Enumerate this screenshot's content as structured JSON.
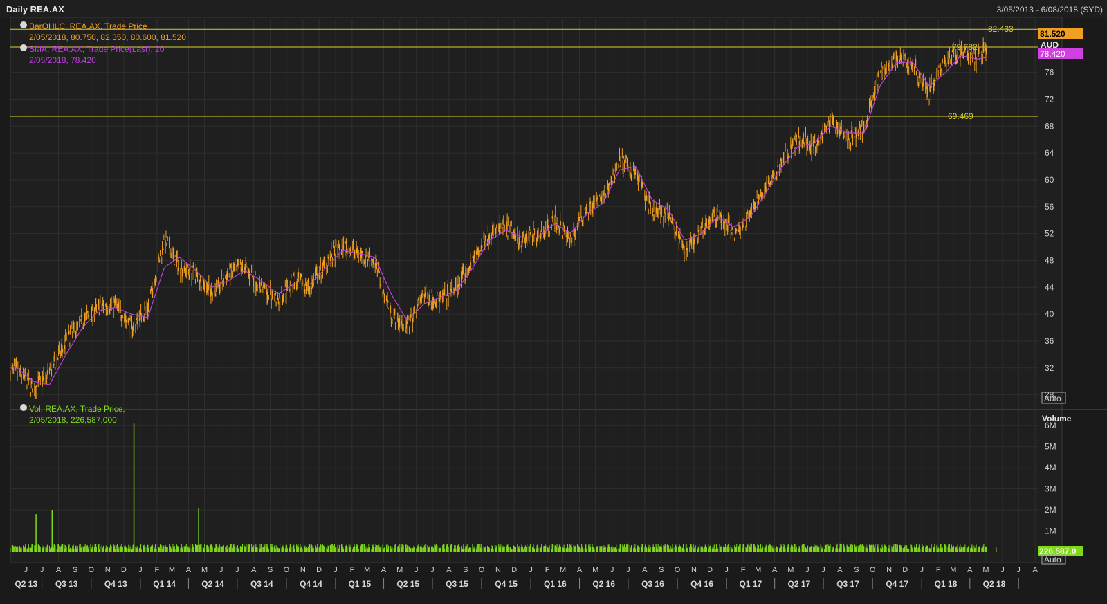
{
  "header": {
    "title": "Daily REA.AX",
    "date_range": "3/05/2013 - 6/08/2018 (SYD)"
  },
  "price_panel": {
    "legend_bar": "BarOHLC, REA.AX, Trade Price",
    "legend_bar_values": "2/05/2018, 80.750, 82.350, 80.600, 81.520",
    "legend_sma": "SMA, REA.AX, Trade Price(Last),  20",
    "legend_sma_values": "2/05/2018, 78.420",
    "currency_label": "AUD",
    "last_price_label": "81.520",
    "sma_price_label": "78.420",
    "auto_label": "Auto",
    "y_ticks": [
      "28",
      "32",
      "36",
      "40",
      "44",
      "48",
      "52",
      "56",
      "60",
      "64",
      "68",
      "72",
      "76"
    ],
    "horizontal_lines": [
      {
        "value": 82.433,
        "label": "82.433"
      },
      {
        "value": 79.782,
        "label": "79.782"
      },
      {
        "value": 69.469,
        "label": "69.469"
      }
    ]
  },
  "volume_panel": {
    "legend_vol": "Vol, REA.AX, Trade Price,",
    "legend_vol_values": "2/05/2018, 226,587.000",
    "axis_title": "Volume",
    "last_volume_label": "226,587.0",
    "auto_label": "Auto",
    "y_ticks": [
      "1M",
      "2M",
      "3M",
      "4M",
      "5M",
      "6M"
    ]
  },
  "x_axis": {
    "months": [
      "J",
      "J",
      "A",
      "S",
      "O",
      "N",
      "D",
      "J",
      "F",
      "M",
      "A",
      "M",
      "J",
      "J",
      "A",
      "S",
      "O",
      "N",
      "D",
      "J",
      "F",
      "M",
      "A",
      "M",
      "J",
      "J",
      "A",
      "S",
      "O",
      "N",
      "D",
      "J",
      "F",
      "M",
      "A",
      "M",
      "J",
      "J",
      "A",
      "S",
      "O",
      "N",
      "D",
      "J",
      "F",
      "M",
      "A",
      "M",
      "J",
      "J",
      "A",
      "S",
      "O",
      "N",
      "D",
      "J",
      "F",
      "M",
      "A",
      "M",
      "J",
      "J",
      "A"
    ],
    "quarters": [
      "Q2 13",
      "Q3 13",
      "Q4 13",
      "Q1 14",
      "Q2 14",
      "Q3 14",
      "Q4 14",
      "Q1 15",
      "Q2 15",
      "Q3 15",
      "Q4 15",
      "Q1 16",
      "Q2 16",
      "Q3 16",
      "Q4 16",
      "Q1 17",
      "Q2 17",
      "Q3 17",
      "Q4 17",
      "Q1 18",
      "Q2 18"
    ]
  },
  "colors": {
    "background": "#1a1a1a",
    "grid": "#2f2f2f",
    "price_bars": "#f0a020",
    "sma": "#c040e0",
    "volume": "#7fd81a",
    "hline": "#d8d030",
    "legend_vol": "#7fd81a"
  },
  "chart_data": {
    "type": "line",
    "title": "Daily REA.AX",
    "series": [
      {
        "name": "BarOHLC, REA.AX, Trade Price",
        "x": [
          "2013-05",
          "2013-06",
          "2013-07",
          "2013-08",
          "2013-09",
          "2013-10",
          "2013-11",
          "2013-12",
          "2014-01",
          "2014-02",
          "2014-03",
          "2014-04",
          "2014-05",
          "2014-06",
          "2014-07",
          "2014-08",
          "2014-09",
          "2014-10",
          "2014-11",
          "2014-12",
          "2015-01",
          "2015-02",
          "2015-03",
          "2015-04",
          "2015-05",
          "2015-06",
          "2015-07",
          "2015-08",
          "2015-09",
          "2015-10",
          "2015-11",
          "2015-12",
          "2016-01",
          "2016-02",
          "2016-03",
          "2016-04",
          "2016-05",
          "2016-06",
          "2016-07",
          "2016-08",
          "2016-09",
          "2016-10",
          "2016-11",
          "2016-12",
          "2017-01",
          "2017-02",
          "2017-03",
          "2017-04",
          "2017-05",
          "2017-06",
          "2017-07",
          "2017-08",
          "2017-09",
          "2017-10",
          "2017-11",
          "2017-12",
          "2018-01",
          "2018-02",
          "2018-03",
          "2018-04",
          "2018-05"
        ],
        "values": [
          31.5,
          29,
          31,
          36,
          39,
          41,
          41.5,
          38,
          41,
          51,
          47,
          46,
          43,
          46,
          47,
          44,
          42,
          45,
          44,
          48,
          50,
          49,
          48,
          40,
          38,
          43,
          42,
          44,
          48,
          52,
          53,
          51,
          52,
          54,
          51,
          56,
          57,
          63,
          61,
          55,
          55,
          49,
          53,
          55,
          52,
          55,
          59,
          63,
          66,
          65,
          69,
          66,
          68,
          76,
          78,
          77,
          73,
          78,
          79,
          78,
          81.5
        ]
      },
      {
        "name": "SMA, REA.AX, Trade Price(Last),  20",
        "x": [
          "2013-05",
          "2013-06",
          "2013-07",
          "2013-08",
          "2013-09",
          "2013-10",
          "2013-11",
          "2013-12",
          "2014-01",
          "2014-02",
          "2014-03",
          "2014-04",
          "2014-05",
          "2014-06",
          "2014-07",
          "2014-08",
          "2014-09",
          "2014-10",
          "2014-11",
          "2014-12",
          "2015-01",
          "2015-02",
          "2015-03",
          "2015-04",
          "2015-05",
          "2015-06",
          "2015-07",
          "2015-08",
          "2015-09",
          "2015-10",
          "2015-11",
          "2015-12",
          "2016-01",
          "2016-02",
          "2016-03",
          "2016-04",
          "2016-05",
          "2016-06",
          "2016-07",
          "2016-08",
          "2016-09",
          "2016-10",
          "2016-11",
          "2016-12",
          "2017-01",
          "2017-02",
          "2017-03",
          "2017-04",
          "2017-05",
          "2017-06",
          "2017-07",
          "2017-08",
          "2017-09",
          "2017-10",
          "2017-11",
          "2017-12",
          "2018-01",
          "2018-02",
          "2018-03",
          "2018-04",
          "2018-05"
        ],
        "values": [
          32,
          30,
          29.5,
          34,
          38,
          40.5,
          41,
          40,
          39.5,
          47,
          48.5,
          46.5,
          44,
          45,
          46.5,
          45,
          43,
          44.5,
          44.5,
          47,
          49.5,
          49,
          48.5,
          43,
          39,
          41.5,
          42.5,
          43.5,
          47,
          51,
          52.5,
          51.5,
          51.5,
          53.5,
          52,
          55,
          56.5,
          61.5,
          62,
          57,
          55.5,
          51,
          52,
          54.5,
          53,
          54.5,
          58,
          62,
          65,
          65.5,
          68,
          67,
          67,
          74,
          77.5,
          77.5,
          74,
          76,
          78.5,
          78,
          78.42
        ]
      },
      {
        "name": "Vol, REA.AX, Trade Price,",
        "x": [
          "2013-05",
          "2013-06",
          "2013-07",
          "2013-12",
          "2014-04",
          "2018-05"
        ],
        "values": [
          300000,
          1800000,
          2000000,
          6100000,
          2100000,
          226587
        ]
      }
    ],
    "y_ticks": [
      28,
      32,
      36,
      40,
      44,
      48,
      52,
      56,
      60,
      64,
      68,
      72,
      76
    ],
    "ylim": [
      26,
      84
    ],
    "volume_ylim": [
      0,
      6500000
    ],
    "volume_ticks": [
      1000000,
      2000000,
      3000000,
      4000000,
      5000000,
      6000000
    ],
    "grid": true
  }
}
